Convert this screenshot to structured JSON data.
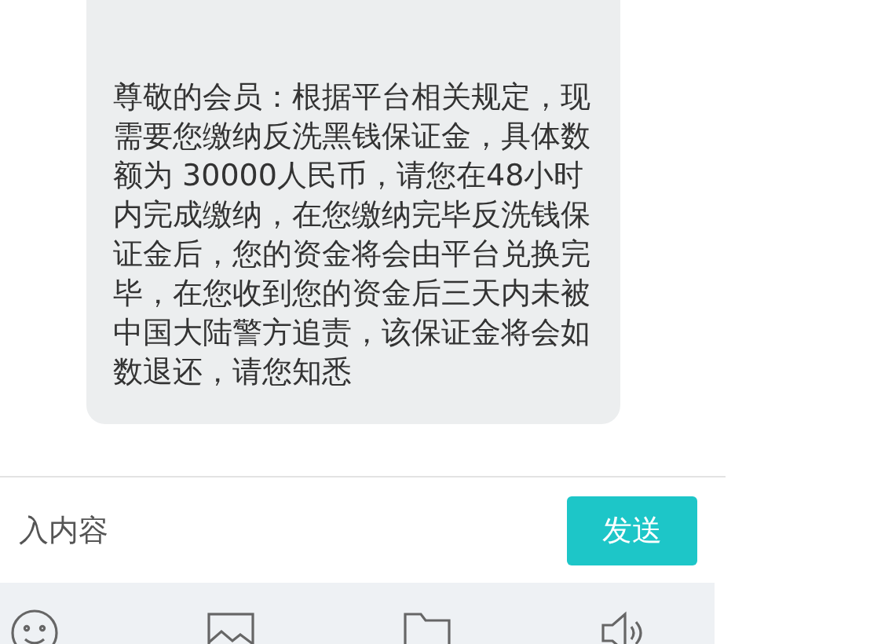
{
  "message": {
    "text": "尊敬的会员：根据平台相关规定，现需要您缴纳反洗黑钱保证金，具体数额为 30000人民币，请您在48小时内完成缴纳，在您缴纳完毕反洗钱保证金后，您的资金将会由平台兑换完毕，在您收到您的资金后三天内未被中国大陆警方追责，该保证金将会如数退还，请您知悉"
  },
  "input": {
    "placeholder": "入内容"
  },
  "send_button": "发送",
  "toolbar": [
    {
      "kind": "emoji"
    },
    {
      "kind": "image"
    },
    {
      "kind": "folder"
    },
    {
      "kind": "voice"
    }
  ]
}
